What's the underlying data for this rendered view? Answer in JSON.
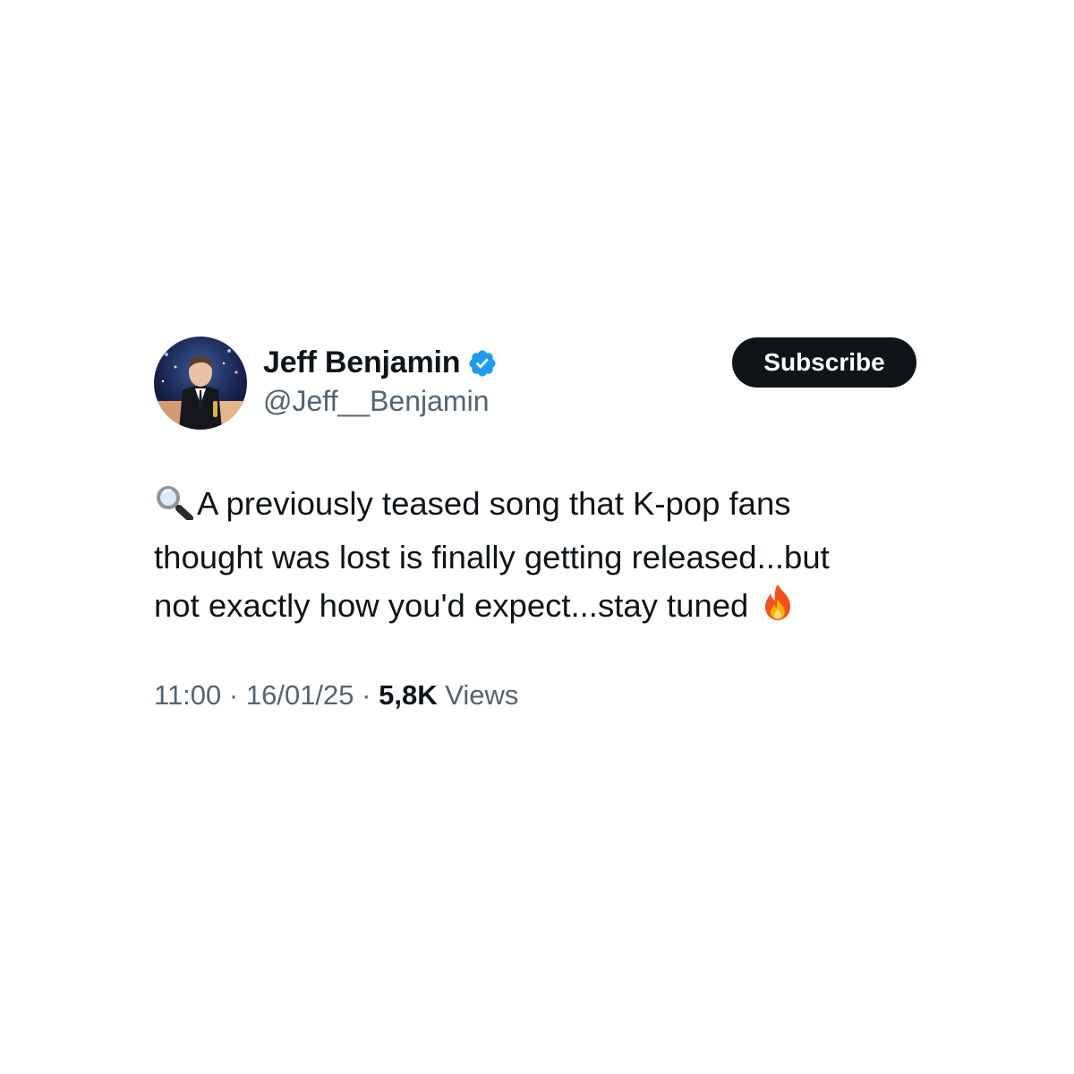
{
  "author": {
    "display_name": "Jeff Benjamin",
    "handle": "@Jeff__Benjamin",
    "verified": true
  },
  "actions": {
    "subscribe_label": "Subscribe"
  },
  "post": {
    "lines": [
      "A previously teased song that K-pop fans",
      "thought was lost is finally getting released...but",
      "not exactly how you'd expect...stay tuned"
    ],
    "leading_emoji": "magnifying-glass-icon",
    "trailing_emoji": "fire-icon"
  },
  "meta": {
    "time": "11:00",
    "separator": "·",
    "date": "16/01/25",
    "views_count": "5,8K",
    "views_label": "Views"
  },
  "colors": {
    "text_primary": "#0f1419",
    "text_secondary": "#536471",
    "button_bg": "#0f1419",
    "verified_blue": "#1d9bf0"
  }
}
